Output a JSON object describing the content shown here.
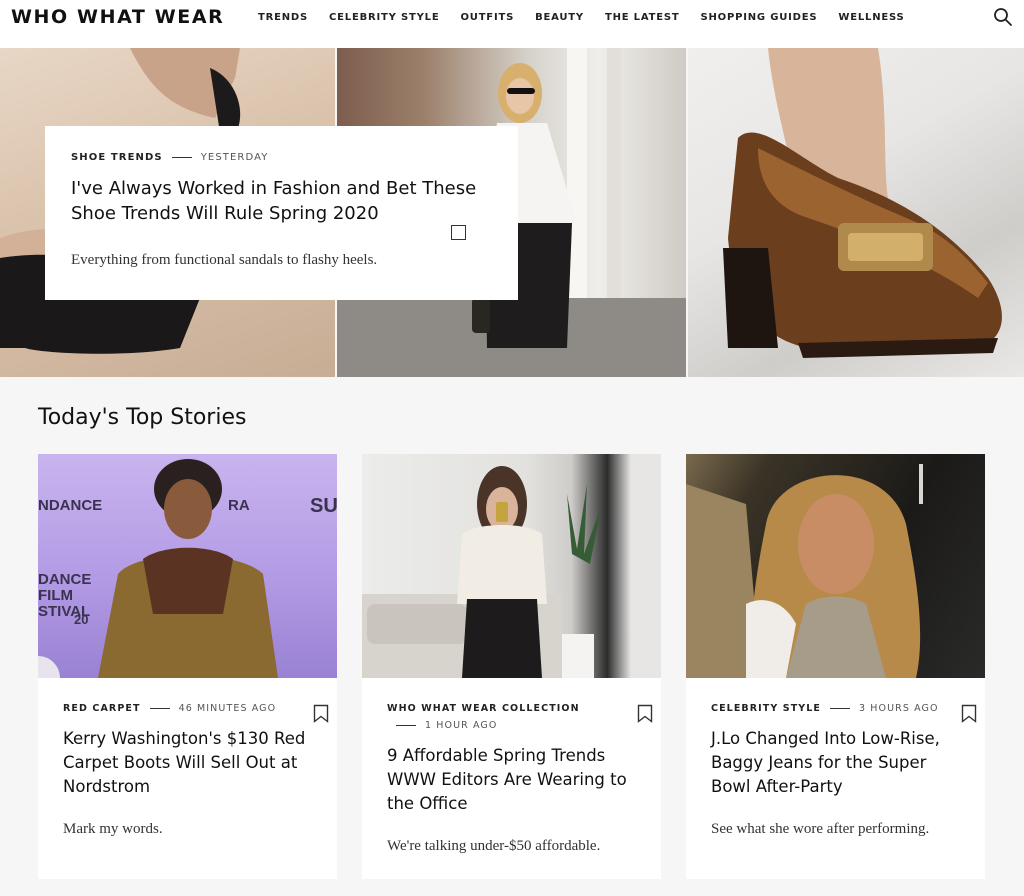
{
  "header": {
    "logo": "WHO WHAT WEAR",
    "nav": [
      "TRENDS",
      "CELEBRITY STYLE",
      "OUTFITS",
      "BEAUTY",
      "THE LATEST",
      "SHOPPING GUIDES",
      "WELLNESS"
    ],
    "search_icon": "search-icon"
  },
  "hero": {
    "category": "SHOE TRENDS",
    "time": "YESTERDAY",
    "title": "I've Always Worked in Fashion and Bet These Shoe Trends Will Rule Spring 2020",
    "dek": "Everything from functional sandals to flashy heels."
  },
  "section": {
    "title": "Today's Top Stories"
  },
  "stories": [
    {
      "category": "RED CARPET",
      "time": "46 MINUTES AGO",
      "title": "Kerry Washington's $130 Red Carpet Boots Will Sell Out at Nordstrom",
      "dek": "Mark my words.",
      "image_texts": [
        "NDANCE",
        "RA",
        "SU",
        "DANCE",
        "FILM",
        "STIVAL",
        "20"
      ]
    },
    {
      "category": "WHO WHAT WEAR COLLECTION",
      "time": "1 HOUR AGO",
      "title": "9 Affordable Spring Trends WWW Editors Are Wearing to the Office",
      "dek": "We're talking under-$50 affordable."
    },
    {
      "category": "CELEBRITY STYLE",
      "time": "3 HOURS AGO",
      "title": "J.Lo Changed Into Low-Rise, Baggy Jeans for the Super Bowl After-Party",
      "dek": "See what she wore after performing."
    }
  ]
}
